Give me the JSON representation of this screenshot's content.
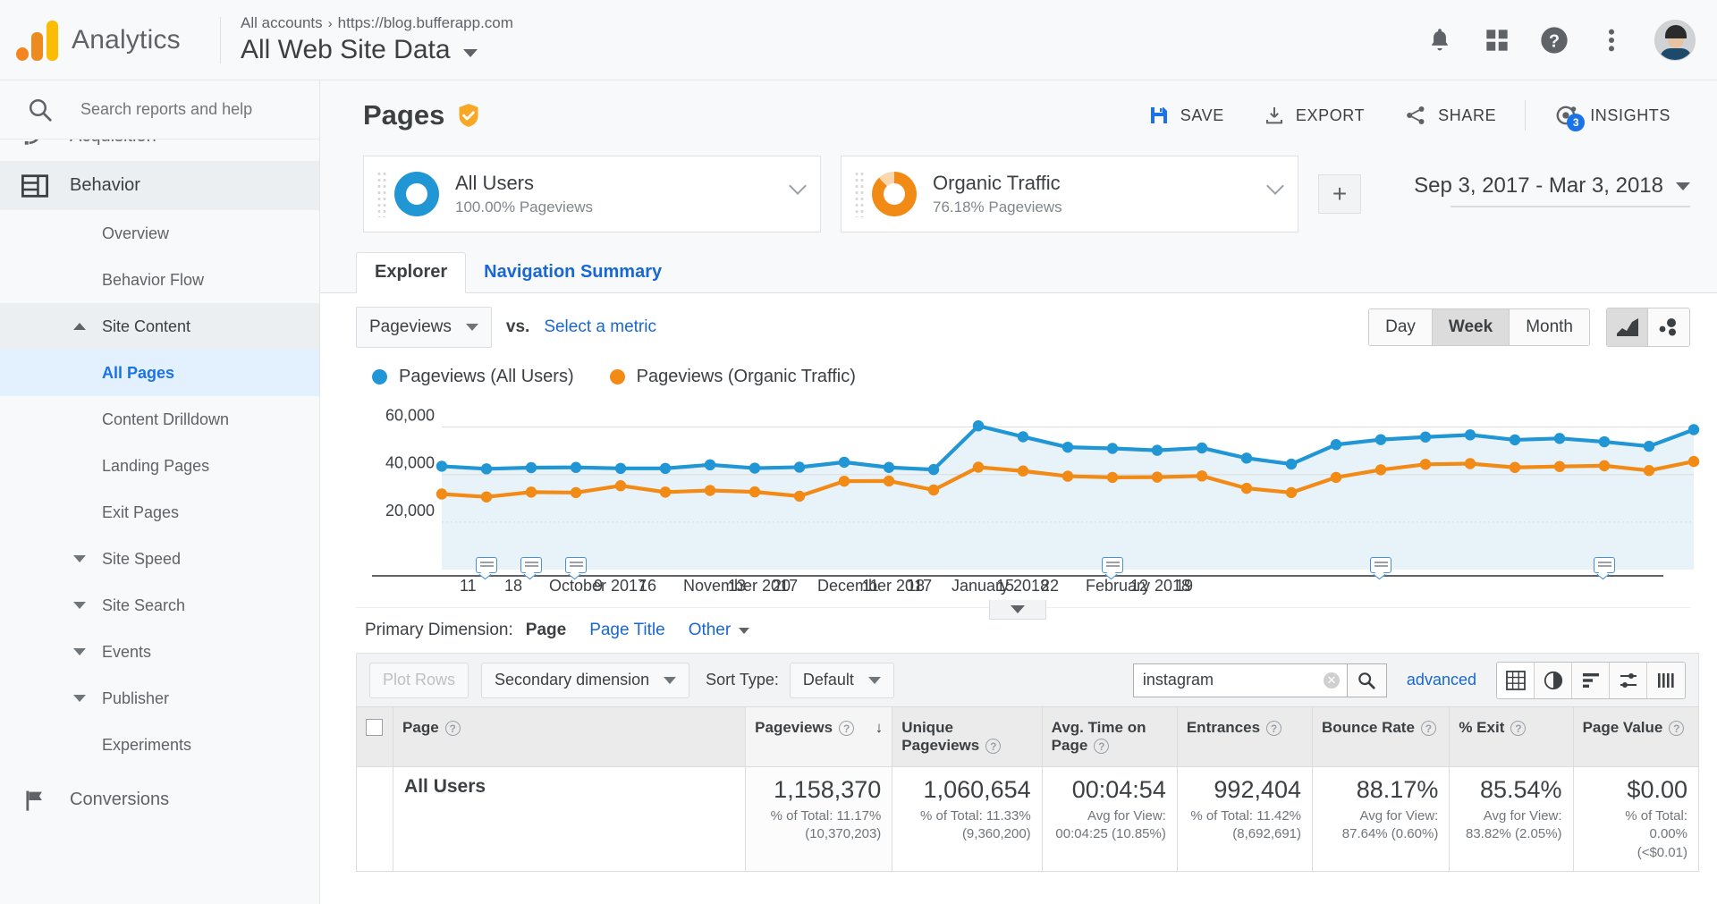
{
  "topbar": {
    "brand": "Analytics",
    "breadcrumb_account": "All accounts",
    "breadcrumb_sep": "›",
    "breadcrumb_property": "https://blog.bufferapp.com",
    "view_name": "All Web Site Data",
    "icons": [
      "bell-icon",
      "apps-grid-icon",
      "help-icon",
      "more-vert-icon",
      "avatar"
    ]
  },
  "sidebar": {
    "search_placeholder": "Search reports and help",
    "items": [
      {
        "label": "Acquisition",
        "type": "section",
        "icon": "acquisition-icon"
      },
      {
        "label": "Behavior",
        "type": "section",
        "icon": "behavior-icon",
        "selected": true
      },
      {
        "label": "Overview",
        "type": "sub"
      },
      {
        "label": "Behavior Flow",
        "type": "sub"
      },
      {
        "label": "Site Content",
        "type": "group",
        "expanded": true
      },
      {
        "label": "All Pages",
        "type": "sub",
        "active": true
      },
      {
        "label": "Content Drilldown",
        "type": "sub"
      },
      {
        "label": "Landing Pages",
        "type": "sub"
      },
      {
        "label": "Exit Pages",
        "type": "sub"
      },
      {
        "label": "Site Speed",
        "type": "group",
        "expanded": false
      },
      {
        "label": "Site Search",
        "type": "group",
        "expanded": false
      },
      {
        "label": "Events",
        "type": "group",
        "expanded": false
      },
      {
        "label": "Publisher",
        "type": "group",
        "expanded": false
      },
      {
        "label": "Experiments",
        "type": "sub"
      },
      {
        "label": "Conversions",
        "type": "section",
        "icon": "flag-icon"
      }
    ]
  },
  "page": {
    "title": "Pages",
    "badge_icon": "verified-shield-icon",
    "actions": [
      {
        "label": "SAVE",
        "icon": "save-icon"
      },
      {
        "label": "EXPORT",
        "icon": "download-icon"
      },
      {
        "label": "SHARE",
        "icon": "share-icon"
      },
      {
        "label": "INSIGHTS",
        "icon": "insights-icon",
        "badge": "3"
      }
    ]
  },
  "segments": [
    {
      "name": "All Users",
      "sub": "100.00% Pageviews",
      "color": "#2196d4"
    },
    {
      "name": "Organic Traffic",
      "sub": "76.18% Pageviews",
      "color": "#f28a16"
    }
  ],
  "add_segment_label": "+",
  "date_range": "Sep 3, 2017 - Mar 3, 2018",
  "tabs": [
    {
      "label": "Explorer",
      "active": true
    },
    {
      "label": "Navigation Summary",
      "active": false
    }
  ],
  "metric_controls": {
    "primary_metric": "Pageviews",
    "vs_label": "vs.",
    "select_metric_label": "Select a metric",
    "granularity": [
      "Day",
      "Week",
      "Month"
    ],
    "granularity_selected": "Week",
    "chart_types": [
      "line-chart-icon",
      "motion-chart-icon"
    ]
  },
  "primary_dimension": {
    "label": "Primary Dimension:",
    "selected": "Page",
    "options": [
      "Page Title"
    ],
    "other_label": "Other"
  },
  "table_controls": {
    "plot_rows": "Plot Rows",
    "secondary_dimension": "Secondary dimension",
    "sort_type_label": "Sort Type:",
    "sort_type_value": "Default",
    "search_value": "instagram",
    "advanced": "advanced",
    "view_icons": [
      "table-view-icon",
      "pie-view-icon",
      "bar-view-icon",
      "comparison-view-icon",
      "pivot-view-icon"
    ]
  },
  "table": {
    "columns": [
      "Page",
      "Pageviews",
      "Unique Pageviews",
      "Avg. Time on Page",
      "Entrances",
      "Bounce Rate",
      "% Exit",
      "Page Value"
    ],
    "sorted_column": "Pageviews",
    "sort_direction": "↓",
    "rows": [
      {
        "name": "All Users",
        "cells": [
          {
            "value": "1,158,370",
            "sub1": "% of Total: 11.17%",
            "sub2": "(10,370,203)"
          },
          {
            "value": "1,060,654",
            "sub1": "% of Total: 11.33%",
            "sub2": "(9,360,200)"
          },
          {
            "value": "00:04:54",
            "sub1": "Avg for View:",
            "sub2": "00:04:25 (10.85%)"
          },
          {
            "value": "992,404",
            "sub1": "% of Total: 11.42%",
            "sub2": "(8,692,691)"
          },
          {
            "value": "88.17%",
            "sub1": "Avg for View:",
            "sub2": "87.64% (0.60%)"
          },
          {
            "value": "85.54%",
            "sub1": "Avg for View:",
            "sub2": "83.82% (2.05%)"
          },
          {
            "value": "$0.00",
            "sub1": "% of Total:",
            "sub2": "0.00%",
            "sub3": "(<$0.01)"
          }
        ]
      }
    ]
  },
  "chart_data": {
    "type": "line",
    "title": "",
    "xlabel": "",
    "ylabel": "",
    "ylim": [
      0,
      70000
    ],
    "yticks": [
      20000,
      40000,
      60000
    ],
    "ytick_labels": [
      "20,000",
      "40,000",
      "60,000"
    ],
    "grid": true,
    "legend_position": "top-left",
    "legend": [
      "Pageviews (All Users)",
      "Pageviews (Organic Traffic)"
    ],
    "colors": [
      "#2196d4",
      "#f28a16"
    ],
    "x_tick_labels": [
      "11",
      "18",
      "October 2017",
      "9",
      "16",
      "November 2017",
      "13",
      "20",
      "December 2017",
      "11",
      "18",
      "January 2018",
      "15",
      "22",
      "February 2018",
      "12",
      "19"
    ],
    "annotation_markers": 6,
    "series": [
      {
        "name": "Pageviews (All Users)",
        "values": [
          43500,
          42400,
          42900,
          43000,
          42600,
          42600,
          44100,
          42700,
          43100,
          45200,
          43000,
          42100,
          60500,
          55900,
          51500,
          51000,
          50200,
          51200,
          46900,
          44400,
          52600,
          54700,
          55800,
          56700,
          54600,
          55200,
          53800,
          51900,
          58900
        ]
      },
      {
        "name": "Pageviews (Organic Traffic)",
        "values": [
          31800,
          30600,
          32600,
          32400,
          35300,
          32600,
          33300,
          32700,
          30900,
          37200,
          37300,
          33500,
          43100,
          41500,
          39300,
          38800,
          38900,
          39400,
          34200,
          32400,
          38800,
          42000,
          44300,
          44600,
          43000,
          43400,
          43700,
          41700,
          45500
        ]
      }
    ]
  }
}
